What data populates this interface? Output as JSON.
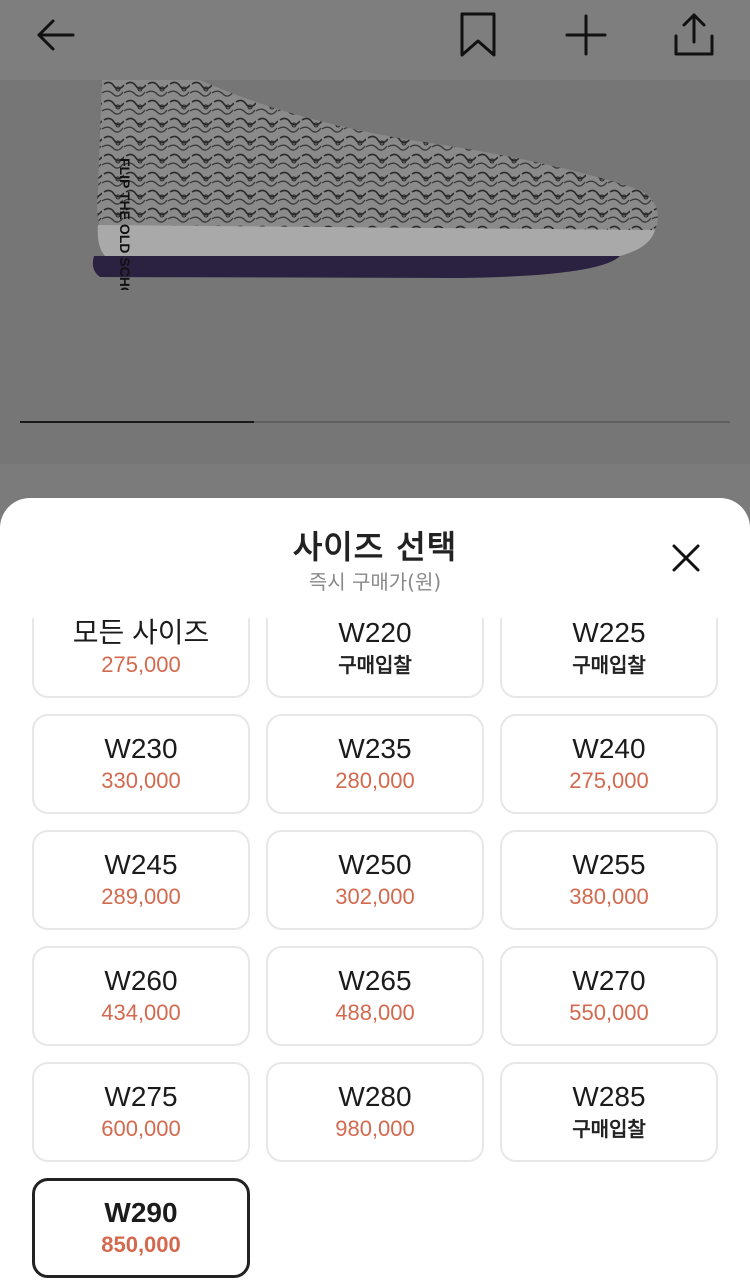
{
  "colors": {
    "price": "#d3694e",
    "text": "#222222",
    "border": "#e7e7e7",
    "selected_border": "#222222",
    "overlay": "#7b7b7b"
  },
  "header": {
    "back_icon": "arrow-left-icon",
    "bookmark_icon": "bookmark-icon",
    "add_icon": "plus-icon",
    "share_icon": "share-icon"
  },
  "gallery": {
    "image": "product-sneaker-image",
    "progress_fraction": 0.33
  },
  "sheet": {
    "title": "사이즈 선택",
    "subtitle": "즉시 구매가(원)",
    "close_icon": "close-icon"
  },
  "sizes": [
    {
      "size": "모든 사이즈",
      "price": "275,000",
      "type": "price"
    },
    {
      "size": "W220",
      "price": "구매입찰",
      "type": "bid"
    },
    {
      "size": "W225",
      "price": "구매입찰",
      "type": "bid"
    },
    {
      "size": "W230",
      "price": "330,000",
      "type": "price"
    },
    {
      "size": "W235",
      "price": "280,000",
      "type": "price"
    },
    {
      "size": "W240",
      "price": "275,000",
      "type": "price"
    },
    {
      "size": "W245",
      "price": "289,000",
      "type": "price"
    },
    {
      "size": "W250",
      "price": "302,000",
      "type": "price"
    },
    {
      "size": "W255",
      "price": "380,000",
      "type": "price"
    },
    {
      "size": "W260",
      "price": "434,000",
      "type": "price"
    },
    {
      "size": "W265",
      "price": "488,000",
      "type": "price"
    },
    {
      "size": "W270",
      "price": "550,000",
      "type": "price"
    },
    {
      "size": "W275",
      "price": "600,000",
      "type": "price"
    },
    {
      "size": "W280",
      "price": "980,000",
      "type": "price"
    },
    {
      "size": "W285",
      "price": "구매입찰",
      "type": "bid"
    },
    {
      "size": "W290",
      "price": "850,000",
      "type": "price",
      "selected": true
    }
  ]
}
